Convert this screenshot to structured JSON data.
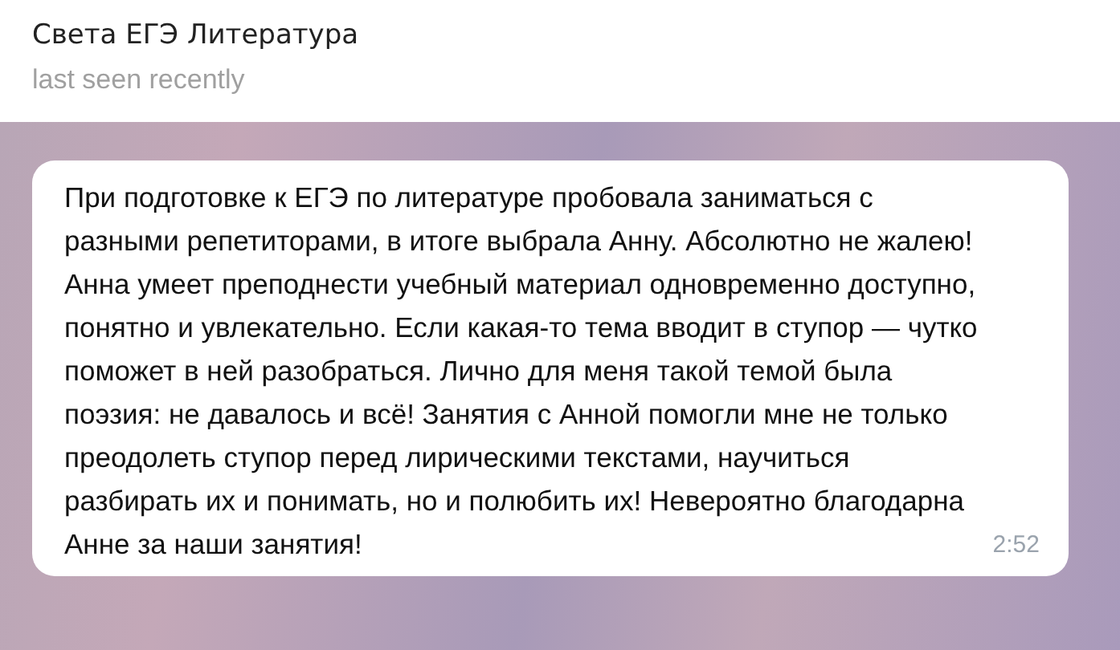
{
  "header": {
    "title": "Света ЕГЭ Литература",
    "status": "last seen recently"
  },
  "messages": [
    {
      "text": "При подготовке к ЕГЭ по литературе пробовала заниматься с разными репетиторами, в итоге выбрала Анну. Абсолютно не жалею! Анна умеет преподнести учебный материал одновременно доступно, понятно и увлекательно. Если какая-то тема вводит в ступор — чутко поможет в ней разобраться. Лично для меня такой темой была поэзия: не давалось и всё! Занятия с Анной помогли мне не только преодолеть ступор перед лирическими текстами, научиться разбирать их и понимать, но и полюбить их! Невероятно благодарна Анне за наши занятия!",
      "time": "2:52"
    }
  ]
}
